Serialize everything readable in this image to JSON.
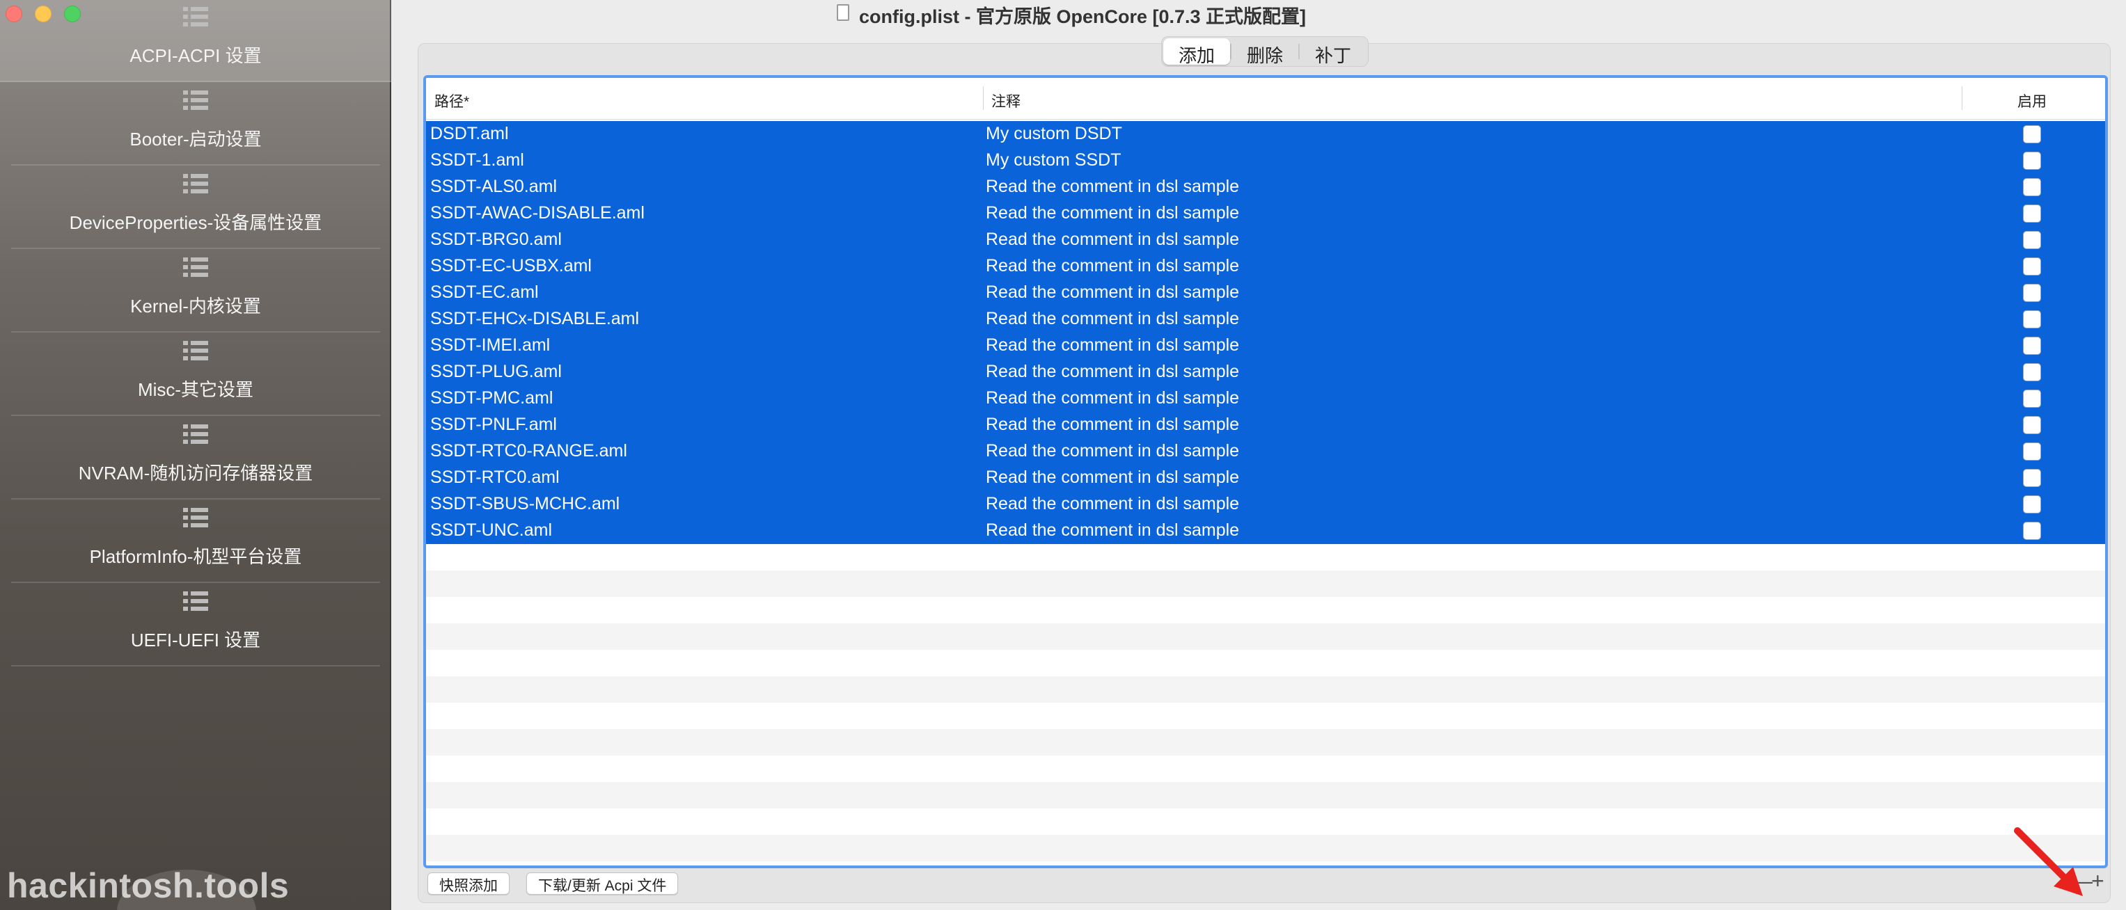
{
  "window": {
    "title": "config.plist - 官方原版 OpenCore [0.7.3 正式版配置]"
  },
  "sidebar": {
    "items": [
      {
        "label": "ACPI-ACPI 设置",
        "icon": "list-icon",
        "active": true
      },
      {
        "label": "Booter-启动设置",
        "icon": "list-icon",
        "active": false
      },
      {
        "label": "DeviceProperties-设备属性设置",
        "icon": "list-icon",
        "active": false
      },
      {
        "label": "Kernel-内核设置",
        "icon": "list-icon",
        "active": false
      },
      {
        "label": "Misc-其它设置",
        "icon": "list-icon",
        "active": false
      },
      {
        "label": "NVRAM-随机访问存储器设置",
        "icon": "list-icon",
        "active": false
      },
      {
        "label": "PlatformInfo-机型平台设置",
        "icon": "list-icon",
        "active": false
      },
      {
        "label": "UEFI-UEFI 设置",
        "icon": "list-icon",
        "active": false
      }
    ],
    "watermark": "hackintosh.tools"
  },
  "tabs": [
    {
      "label": "添加",
      "selected": true
    },
    {
      "label": "删除",
      "selected": false
    },
    {
      "label": "补丁",
      "selected": false
    }
  ],
  "table": {
    "columns": {
      "path": "路径*",
      "comment": "注释",
      "enabled": "启用"
    },
    "rows": [
      {
        "path": "DSDT.aml",
        "comment": "My custom DSDT",
        "enabled": false
      },
      {
        "path": "SSDT-1.aml",
        "comment": "My custom SSDT",
        "enabled": false
      },
      {
        "path": "SSDT-ALS0.aml",
        "comment": "Read the comment in dsl sample",
        "enabled": false
      },
      {
        "path": "SSDT-AWAC-DISABLE.aml",
        "comment": "Read the comment in dsl sample",
        "enabled": false
      },
      {
        "path": "SSDT-BRG0.aml",
        "comment": "Read the comment in dsl sample",
        "enabled": false
      },
      {
        "path": "SSDT-EC-USBX.aml",
        "comment": "Read the comment in dsl sample",
        "enabled": false
      },
      {
        "path": "SSDT-EC.aml",
        "comment": "Read the comment in dsl sample",
        "enabled": false
      },
      {
        "path": "SSDT-EHCx-DISABLE.aml",
        "comment": "Read the comment in dsl sample",
        "enabled": false
      },
      {
        "path": "SSDT-IMEI.aml",
        "comment": "Read the comment in dsl sample",
        "enabled": false
      },
      {
        "path": "SSDT-PLUG.aml",
        "comment": "Read the comment in dsl sample",
        "enabled": false
      },
      {
        "path": "SSDT-PMC.aml",
        "comment": "Read the comment in dsl sample",
        "enabled": false
      },
      {
        "path": "SSDT-PNLF.aml",
        "comment": "Read the comment in dsl sample",
        "enabled": false
      },
      {
        "path": "SSDT-RTC0-RANGE.aml",
        "comment": "Read the comment in dsl sample",
        "enabled": false
      },
      {
        "path": "SSDT-RTC0.aml",
        "comment": "Read the comment in dsl sample",
        "enabled": false
      },
      {
        "path": "SSDT-SBUS-MCHC.aml",
        "comment": "Read the comment in dsl sample",
        "enabled": false
      },
      {
        "path": "SSDT-UNC.aml",
        "comment": "Read the comment in dsl sample",
        "enabled": false
      }
    ]
  },
  "bottom_bar": {
    "quick_add_label": "快照添加",
    "download_label": "下载/更新 Acpi 文件",
    "minus_label": "—",
    "plus_label": "+"
  },
  "colors": {
    "selection": "#0a63d8",
    "table_border": "#5a9bef",
    "annotation_arrow": "#e8231e"
  }
}
